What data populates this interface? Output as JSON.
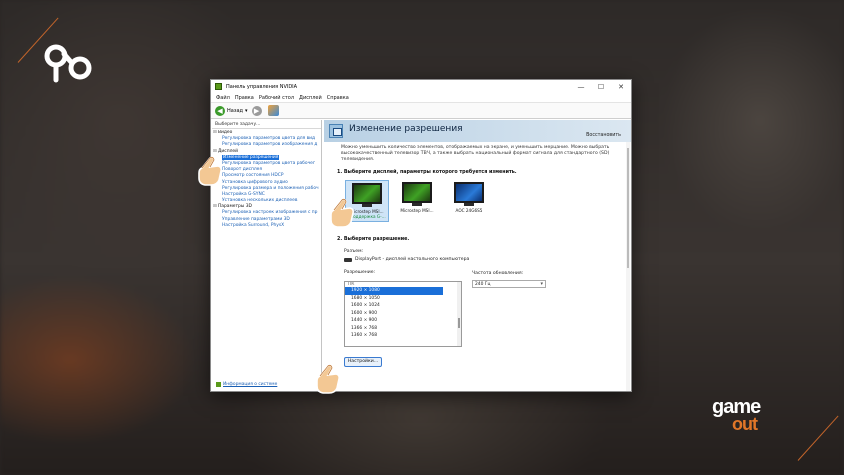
{
  "window": {
    "title": "Панель управления NVIDIA",
    "menu": [
      "Файл",
      "Правка",
      "Рабочий стол",
      "Дисплей",
      "Справка"
    ],
    "toolbar": {
      "back_label": "Назад"
    }
  },
  "left_pane": {
    "header": "Выберите задачу...",
    "tree": [
      {
        "label": "Видео",
        "type": "category",
        "toggle": "⊟"
      },
      {
        "label": "Регулировка параметров цвета для вид",
        "type": "item"
      },
      {
        "label": "Регулировка параметров изображения д",
        "type": "item"
      },
      {
        "label": "Дисплей",
        "type": "category",
        "toggle": "⊟"
      },
      {
        "label": "Изменение разрешения",
        "type": "item",
        "selected": true
      },
      {
        "label": "Регулировка параметров цвета рабочег",
        "type": "item"
      },
      {
        "label": "Поворот дисплея",
        "type": "item"
      },
      {
        "label": "Просмотр состояния HDCP",
        "type": "item"
      },
      {
        "label": "Установка цифрового аудио",
        "type": "item"
      },
      {
        "label": "Регулировка размера и положения рабоч",
        "type": "item"
      },
      {
        "label": "Настройка G-SYNC",
        "type": "item"
      },
      {
        "label": "Установка нескольких дисплеев",
        "type": "item"
      },
      {
        "label": "Параметры 3D",
        "type": "category",
        "toggle": "⊟"
      },
      {
        "label": "Регулировка настроек изображения с пр",
        "type": "item"
      },
      {
        "label": "Управление параметрами 3D",
        "type": "item"
      },
      {
        "label": "Настройка Surround, PhysX",
        "type": "item"
      }
    ],
    "system_info": "Информация о системе"
  },
  "main": {
    "title": "Изменение разрешения",
    "restore": "Восстановить",
    "description": "Можно уменьшить количество элементов, отображаемых на экране, и уменьшить мерцание. Можно выбрать высококачественный телевизор TBЧ, а также выбрать национальный формат сигнала для стандартного (SD) телевидения.",
    "step1": "1. Выберите дисплей, параметры которого требуется изменить.",
    "monitors": [
      {
        "label": "Microstep MSI...",
        "sub": "[Поддержка G-...",
        "selected": true
      },
      {
        "label": "Microstep MSI...",
        "sub": ""
      },
      {
        "label": "AOC 24G6S5",
        "sub": ""
      }
    ],
    "step2": "2. Выберите разрешение.",
    "connection_label": "Разъем:",
    "connection_value": "DisplayPort - дисплей настольного компьютера",
    "resolution_label": "Разрешение:",
    "resolution_group": "ПК",
    "resolutions": [
      "1920 × 1080",
      "1680 × 1050",
      "1600 × 1024",
      "1600 × 900",
      "1440 × 900",
      "1366 × 768",
      "1360 × 768"
    ],
    "selected_resolution": "1920 × 1080",
    "refresh_label": "Частота обновления:",
    "refresh_value": "240 Гц",
    "settings_button": "Настройки..."
  },
  "overlay": {
    "brand": [
      "game",
      "out"
    ]
  }
}
